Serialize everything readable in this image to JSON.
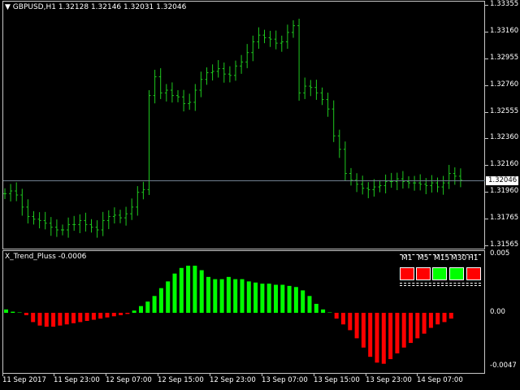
{
  "chart": {
    "symbol_label": "GBPUSD,H1",
    "ohlc": [
      "1.32128",
      "1.32146",
      "1.32031",
      "1.32046"
    ],
    "current_price": "1.32046",
    "price_ticks": [
      "1.33355",
      "1.33160",
      "1.32955",
      "1.32760",
      "1.32555",
      "1.32360",
      "1.32160",
      "1.31960",
      "1.31765",
      "1.31565"
    ],
    "colors": {
      "bar": "#1ec81e",
      "grid": "#c8c8c8",
      "price_line": "#708090",
      "bull": "#00ff00",
      "bear": "#ff0000"
    }
  },
  "indicator": {
    "name_label": "X_Trend_Pluss -0.0006",
    "scale_ticks": [
      "0.005",
      "0.00",
      "-0.0047"
    ],
    "timeframes": [
      {
        "label": "M1",
        "state": "bear"
      },
      {
        "label": "M5",
        "state": "bear"
      },
      {
        "label": "M15",
        "state": "bull"
      },
      {
        "label": "M30",
        "state": "bull"
      },
      {
        "label": "H1",
        "state": "bear"
      }
    ]
  },
  "time_axis": [
    "11 Sep 2017",
    "11 Sep 23:00",
    "12 Sep 07:00",
    "12 Sep 15:00",
    "12 Sep 23:00",
    "13 Sep 07:00",
    "13 Sep 15:00",
    "13 Sep 23:00",
    "14 Sep 07:00"
  ],
  "chart_data": [
    {
      "type": "candlestick",
      "symbol": "GBPUSD",
      "timeframe": "H1",
      "ylim": [
        1.31565,
        1.33355
      ],
      "x_tick_labels": [
        "11 Sep 2017",
        "11 Sep 23:00",
        "12 Sep 07:00",
        "12 Sep 15:00",
        "12 Sep 23:00",
        "13 Sep 07:00",
        "13 Sep 15:00",
        "13 Sep 23:00",
        "14 Sep 07:00"
      ],
      "close": [
        1.3195,
        1.3197,
        1.3194,
        1.3185,
        1.3178,
        1.3176,
        1.3175,
        1.3173,
        1.317,
        1.3168,
        1.3168,
        1.3172,
        1.3172,
        1.3175,
        1.3172,
        1.317,
        1.3168,
        1.3175,
        1.3178,
        1.3179,
        1.3177,
        1.318,
        1.3185,
        1.3196,
        1.3198,
        1.3268,
        1.3282,
        1.327,
        1.3272,
        1.3268,
        1.3267,
        1.3262,
        1.3263,
        1.3272,
        1.328,
        1.3285,
        1.3286,
        1.3288,
        1.3284,
        1.3283,
        1.329,
        1.3293,
        1.33,
        1.3308,
        1.3313,
        1.3311,
        1.331,
        1.3307,
        1.3308,
        1.3315,
        1.332,
        1.327,
        1.3275,
        1.3274,
        1.327,
        1.3265,
        1.3258,
        1.3238,
        1.3228,
        1.321,
        1.3205,
        1.3202,
        1.3199,
        1.3198,
        1.32,
        1.3201,
        1.3204,
        1.3204,
        1.3206,
        1.3204,
        1.3203,
        1.3203,
        1.3202,
        1.3201,
        1.3203,
        1.32,
        1.3203,
        1.321,
        1.3208,
        1.3205
      ]
    },
    {
      "type": "bar",
      "name": "X_Trend_Pluss",
      "ylim": [
        -0.0047,
        0.005
      ],
      "values": [
        0.0003,
        0.0001,
        0,
        -0.0002,
        -0.0008,
        -0.0011,
        -0.0012,
        -0.0012,
        -0.0011,
        -0.001,
        -0.0009,
        -0.0008,
        -0.0007,
        -0.0006,
        -0.0005,
        -0.0004,
        -0.0003,
        -0.0002,
        -0.0001,
        0.0002,
        0.0006,
        0.001,
        0.0015,
        0.0022,
        0.0028,
        0.0035,
        0.004,
        0.0042,
        0.0042,
        0.0038,
        0.0032,
        0.003,
        0.003,
        0.0032,
        0.003,
        0.003,
        0.0028,
        0.0027,
        0.0026,
        0.0026,
        0.0025,
        0.0025,
        0.0024,
        0.0023,
        0.002,
        0.0015,
        0.0008,
        0.0003,
        0,
        -0.0005,
        -0.001,
        -0.0015,
        -0.0022,
        -0.003,
        -0.0038,
        -0.0043,
        -0.0044,
        -0.004,
        -0.0035,
        -0.003,
        -0.0026,
        -0.0022,
        -0.0018,
        -0.0013,
        -0.001,
        -0.0008,
        -0.0005
      ],
      "zero_index_start": 0
    }
  ]
}
